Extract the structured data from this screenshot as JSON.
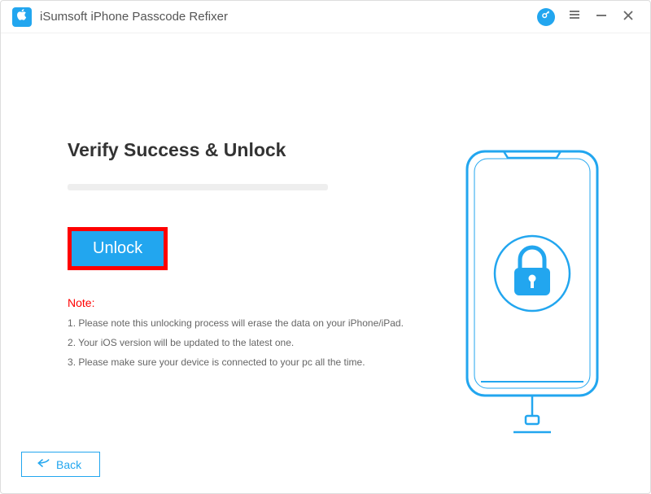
{
  "titlebar": {
    "app_title": "iSumsoft iPhone Passcode Refixer"
  },
  "main": {
    "heading": "Verify Success & Unlock",
    "unlock_button_label": "Unlock",
    "note_label": "Note:",
    "notes": [
      "Please note this unlocking process will erase the data on your iPhone/iPad.",
      "Your iOS version will be updated to the latest one.",
      "Please make sure your device is connected to your pc all the time."
    ]
  },
  "footer": {
    "back_label": "Back"
  },
  "colors": {
    "accent": "#22a6ef",
    "highlight_border": "#ff0000"
  },
  "icons": {
    "app_logo": "apple-icon",
    "help_circle": "key-icon",
    "menu": "menu-icon",
    "minimize": "minimize-icon",
    "close": "close-icon",
    "back_arrow": "back-arrow-icon",
    "device_lock": "lock-icon"
  }
}
